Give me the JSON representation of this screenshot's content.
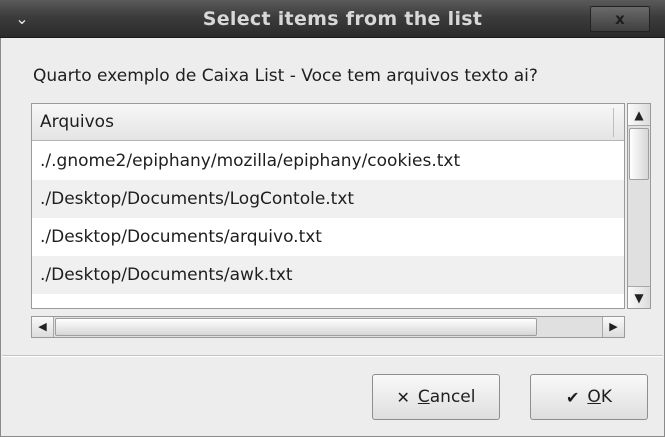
{
  "window": {
    "title": "Select items from the list",
    "menu_icon": "chevron-down-icon",
    "close_glyph": "x"
  },
  "prompt": "Quarto exemplo de Caixa List - Voce tem arquivos texto ai?",
  "list": {
    "column_header": "Arquivos",
    "rows": [
      "./.gnome2/epiphany/mozilla/epiphany/cookies.txt",
      "./Desktop/Documents/LogContole.txt",
      "./Desktop/Documents/arquivo.txt",
      "./Desktop/Documents/awk.txt"
    ]
  },
  "buttons": {
    "cancel": {
      "mnemonic": "C",
      "rest": "ancel",
      "icon": "close-icon"
    },
    "ok": {
      "mnemonic": "O",
      "rest": "K",
      "icon": "checkmark-icon"
    }
  },
  "colors": {
    "titlebar": "#3c3c3c",
    "window_bg": "#ededed",
    "row_alt": "#f0f0f0"
  }
}
